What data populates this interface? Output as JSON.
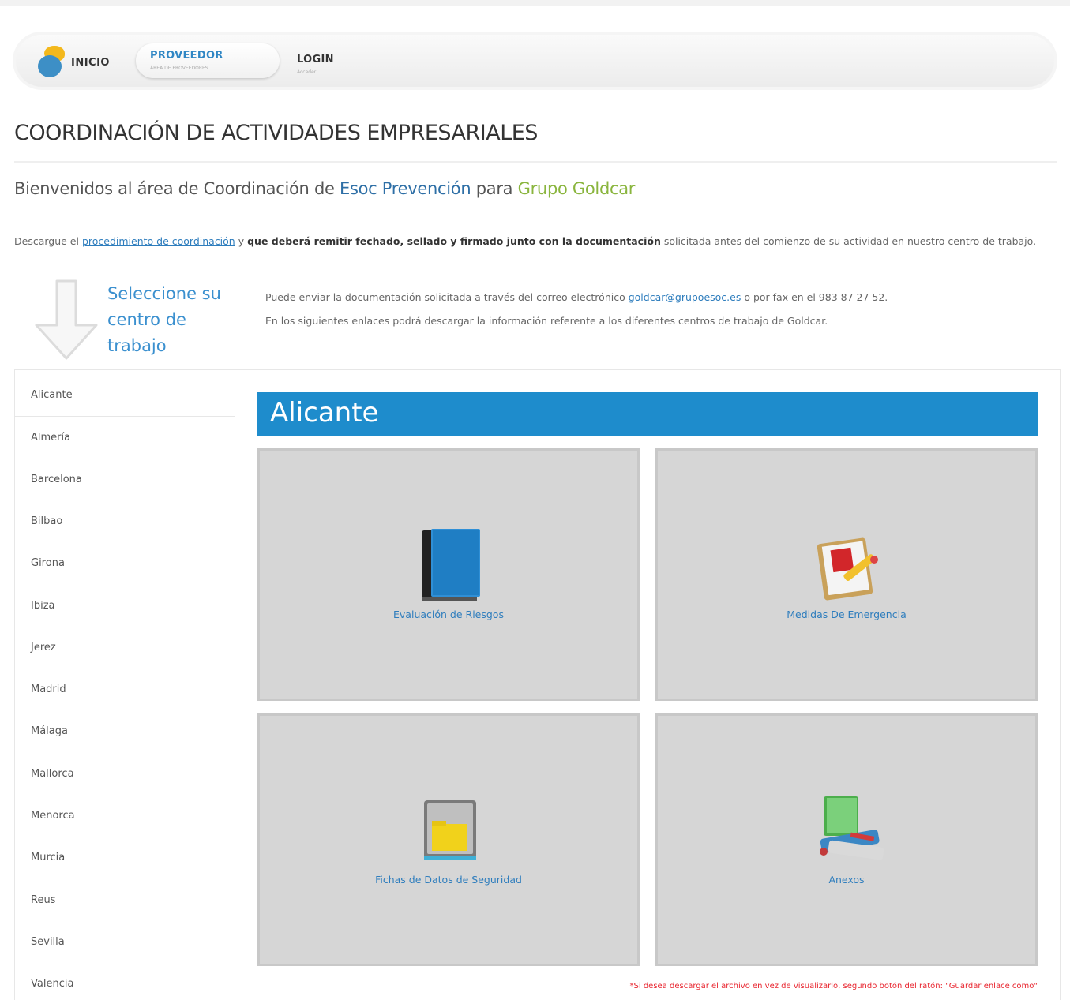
{
  "nav": {
    "inicio": "INICIO",
    "proveedor_title": "PROVEEDOR",
    "proveedor_sub": "ÁREA DE PROVEEDORES",
    "login_title": "LOGIN",
    "login_sub": "Acceder"
  },
  "page": {
    "title": "COORDINACIÓN DE ACTIVIDADES EMPRESARIALES",
    "welcome_prefix": "Bienvenidos al área de Coordinación de ",
    "welcome_company": "Esoc Prevención",
    "welcome_mid": " para ",
    "welcome_client": "Grupo Goldcar",
    "intro_prefix": "Descargue el ",
    "intro_link": "procedimiento de coordinación",
    "intro_mid": " y ",
    "intro_bold": "que deberá remitir fechado, sellado y firmado junto con la documentación",
    "intro_suffix": " solicitada antes del comienzo de su actividad en nuestro centro de trabajo.",
    "select_title": "Seleccione su centro de trabajo",
    "info_prefix": "Puede enviar la documentación solicitada a través del correo electrónico ",
    "info_email": "goldcar@grupoesoc.es",
    "info_suffix": " o por fax en el 983 87 27 52.",
    "info_line2": "En los siguientes enlaces podrá descargar la información referente a los diferentes centros de trabajo de Goldcar."
  },
  "sidebar": {
    "items": [
      "Alicante",
      "Almería",
      "Barcelona",
      "Bilbao",
      "Girona",
      "Ibiza",
      "Jerez",
      "Madrid",
      "Málaga",
      "Mallorca",
      "Menorca",
      "Murcia",
      "Reus",
      "Sevilla",
      "Valencia"
    ],
    "active_index": 0
  },
  "content": {
    "heading": "Alicante",
    "tiles": [
      {
        "label": "Evaluación de Riesgos",
        "icon": "blue-book-icon"
      },
      {
        "label": "Medidas De Emergencia",
        "icon": "clipboard-pencil-icon"
      },
      {
        "label": "Fichas de Datos de Seguridad",
        "icon": "folder-box-icon"
      },
      {
        "label": "Anexos",
        "icon": "books-stack-icon"
      }
    ],
    "note": "*Si desea descargar el archivo en vez de visualizarlo, segundo botón del ratón: \"Guardar enlace como\""
  },
  "colors": {
    "accent_blue": "#1e8ccc",
    "link_blue": "#2e7dbd",
    "client_green": "#8ab53e",
    "note_red": "#e8242e",
    "tile_gray": "#d6d6d6"
  }
}
